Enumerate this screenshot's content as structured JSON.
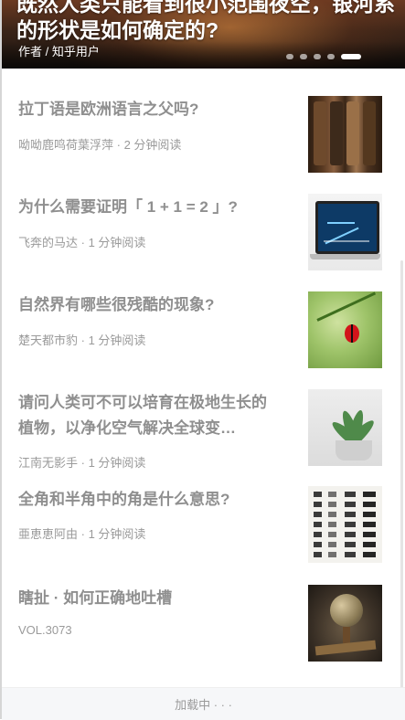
{
  "hero": {
    "title": "既然人类只能看到很小范围夜空，银河系的形状是如何确定的?",
    "author": "作者 / 知乎用户",
    "pager_count": 5,
    "pager_active": 5
  },
  "feed": [
    {
      "title": "拉丁语是欧洲语言之父吗?",
      "author": "呦呦鹿鸣荷葉浮萍",
      "read_time": "2 分钟阅读",
      "thumb": "old-books-image"
    },
    {
      "title": "为什么需要证明「 1 + 1 = 2 」?",
      "author": "飞奔的马达",
      "read_time": "1 分钟阅读",
      "thumb": "laptop-chart-image"
    },
    {
      "title": "自然界有哪些很残酷的现象?",
      "author": "楚天都市豹",
      "read_time": "1 分钟阅读",
      "thumb": "ladybug-image"
    },
    {
      "title": "请问人类可不可以培育在极地生长的植物，以净化空气解决全球变…",
      "author": "江南无影手",
      "read_time": "1 分钟阅读",
      "thumb": "succulent-plant-image"
    },
    {
      "title": "全角和半角中的角是什么意思?",
      "author": "亜恵恵阿由",
      "read_time": "1 分钟阅读",
      "thumb": "calligraphy-image"
    },
    {
      "title": "瞎扯 · 如何正确地吐槽",
      "author": "VOL.3073",
      "read_time": "",
      "thumb": "globe-desk-image"
    }
  ],
  "footer": {
    "loading_label": "加载中 · · ·"
  },
  "colors": {
    "title_gray": "#8f8f8f",
    "meta_gray": "#9a9a9a",
    "footer_bg": "#f6f7f9"
  }
}
